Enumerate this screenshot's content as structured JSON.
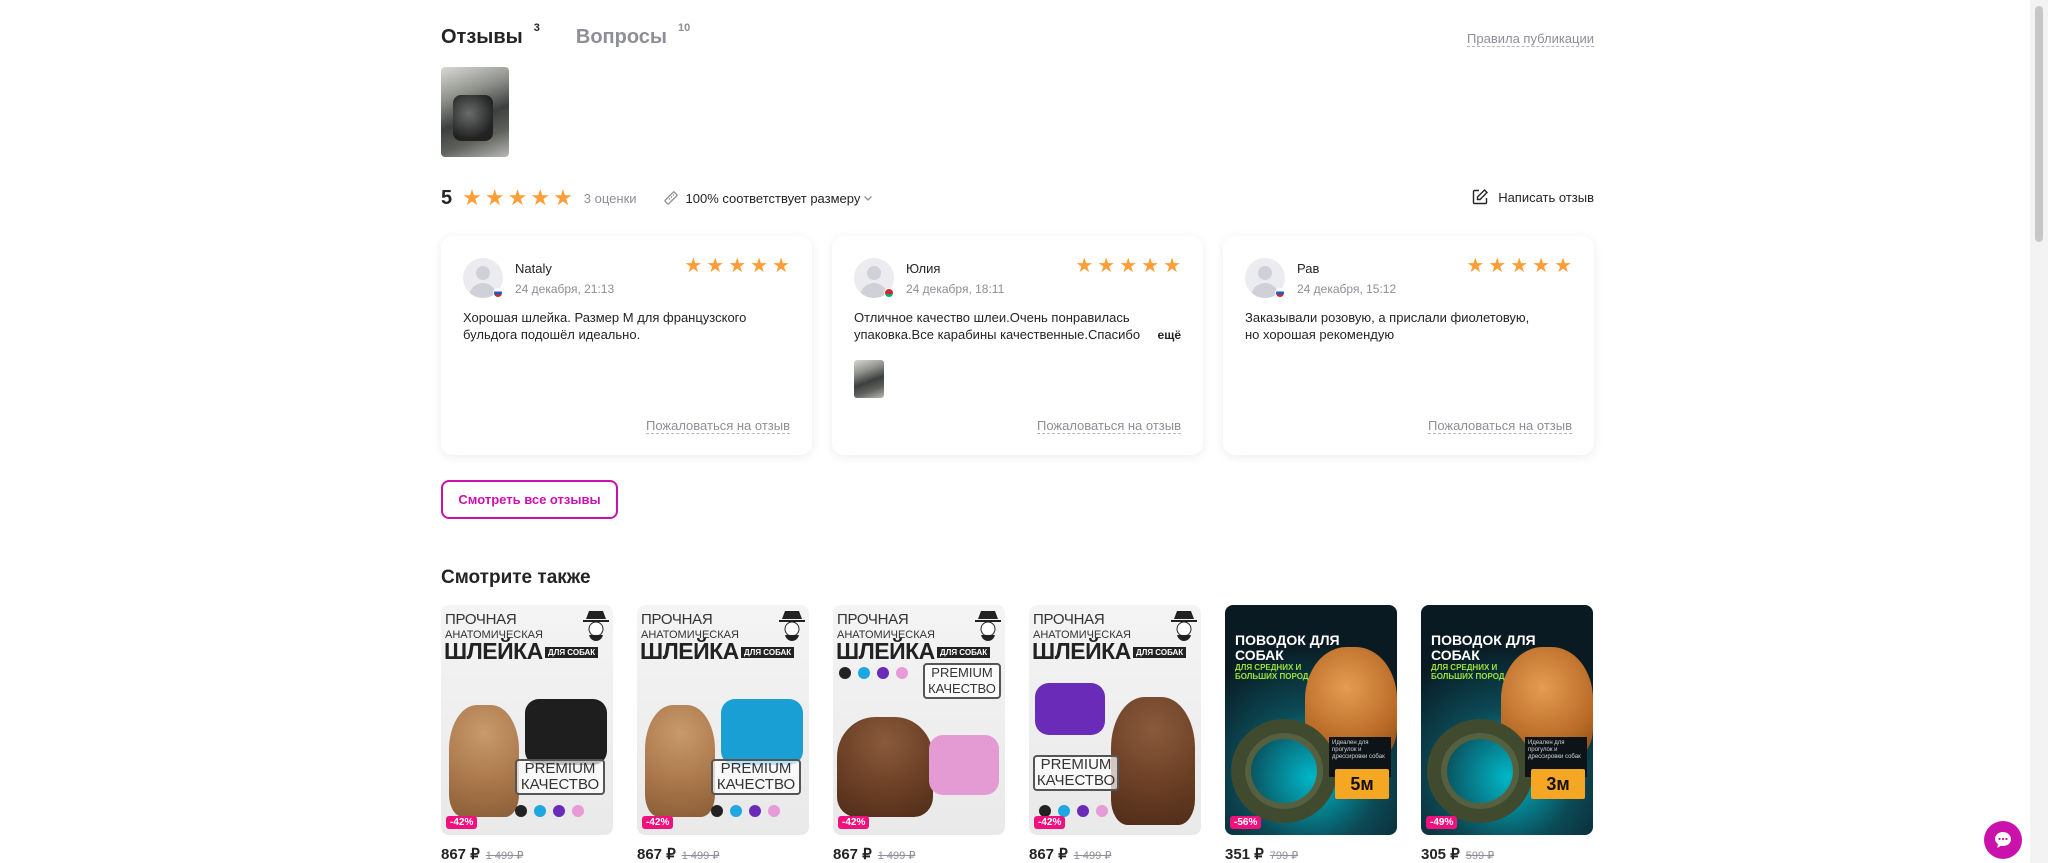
{
  "tabs": [
    {
      "label": "Отзывы",
      "count": "3"
    },
    {
      "label": "Вопросы",
      "count": "10"
    }
  ],
  "rules_link": "Правила публикации",
  "rating": {
    "value": "5",
    "stars": 5,
    "count_label": "3 оценки",
    "size_fit": "100% соответствует размеру",
    "write_review": "Написать отзыв"
  },
  "reviews": [
    {
      "author": "Nataly",
      "date": "24 декабря, 21:13",
      "stars": 5,
      "text": "Хорошая шлейка. Размер М для французского бульдога подошёл идеально.",
      "complain": "Пожаловаться на отзыв",
      "flag": "ru"
    },
    {
      "author": "Юлия",
      "date": "24 декабря, 18:11",
      "stars": 5,
      "text": "Отличное качество шлеи.Очень понравилась упаковка.Все карабины качественные.Спасибо",
      "more": "ещё",
      "complain": "Пожаловаться на отзыв",
      "flag": "by"
    },
    {
      "author": "Рав",
      "date": "24 декабря, 15:12",
      "stars": 5,
      "text": "Заказывали розовую, а прислали фиолетовую, но хорошая рекомендую",
      "complain": "Пожаловаться на отзыв",
      "flag": "ru"
    }
  ],
  "all_reviews_button": "Смотреть все отзывы",
  "see_also": {
    "title": "Смотрите также",
    "harness_text": {
      "line1": "ПРОЧНАЯ",
      "line2": "АНАТОМИЧЕСКАЯ",
      "line3": "ШЛЕЙКА",
      "tag": "ДЛЯ СОБАК",
      "premium1": "PREMIUM",
      "premium2": "КАЧЕСТВО"
    },
    "leash_text": {
      "line1": "ПОВОДОК ДЛЯ СОБАК",
      "line2": "ДЛЯ СРЕДНИХ И БОЛЬШИХ ПОРОД",
      "info": "Идеален для прогулок и дрессировки собак",
      "length_label": "длина:"
    },
    "products": [
      {
        "discount": "-42%",
        "price": "867 ₽",
        "old_price": "1 499 ₽"
      },
      {
        "discount": "-42%",
        "price": "867 ₽",
        "old_price": "1 499 ₽"
      },
      {
        "discount": "-42%",
        "price": "867 ₽",
        "old_price": "1 499 ₽"
      },
      {
        "discount": "-42%",
        "price": "867 ₽",
        "old_price": "1 499 ₽"
      },
      {
        "discount": "-56%",
        "price": "351 ₽",
        "old_price": "799 ₽",
        "length": "5м"
      },
      {
        "discount": "-49%",
        "price": "305 ₽",
        "old_price": "599 ₽",
        "length": "3м"
      }
    ]
  },
  "colors": {
    "accent": "#cb11ab",
    "star": "#ff9e38",
    "discount": "#f1117e",
    "muted": "#8e8e98",
    "text": "#242424"
  }
}
